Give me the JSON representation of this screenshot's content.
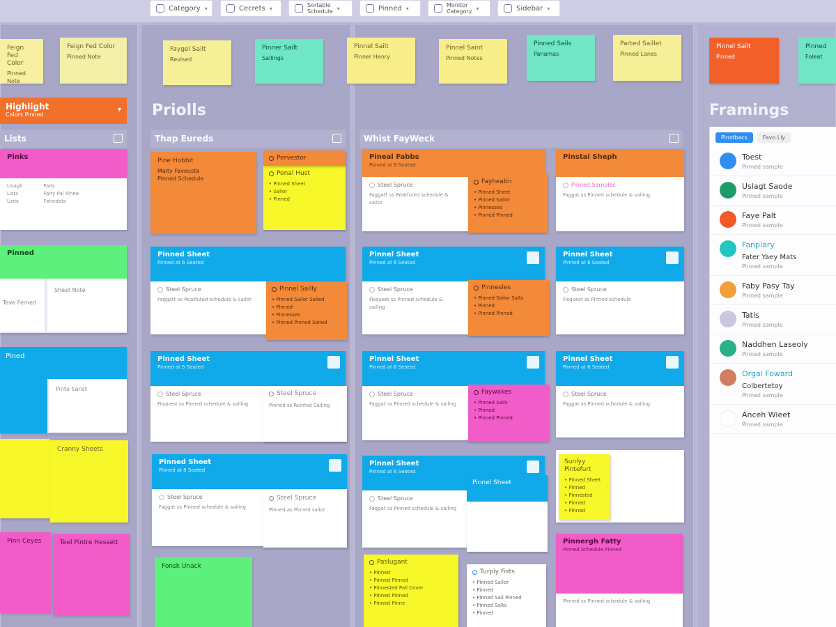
{
  "toolbar": {
    "buttons": [
      {
        "label": "Category"
      },
      {
        "label": "Cecrets"
      },
      {
        "label": "Sortable",
        "sub": "Schedule"
      },
      {
        "label": "Pinned"
      },
      {
        "label": "Monitor",
        "sub": "Category"
      },
      {
        "label": "Sidebar"
      }
    ]
  },
  "top_notes": [
    {
      "title": "Feign Fed Color",
      "sub": "Pinned Note"
    },
    {
      "title": "Faygel Sailt",
      "sub": "Revised"
    },
    {
      "title": "Pinner Sailt",
      "sub": "Sailings"
    },
    {
      "title": "Pinnel Sailt",
      "sub": "Pinner Henry"
    },
    {
      "title": "Pinnel Saint",
      "sub": "Pinned Notes"
    },
    {
      "title": "Pinned Sails",
      "sub": "Panamas"
    },
    {
      "title": "Parted Saillet",
      "sub": "Pinned Lanes"
    },
    {
      "title": "Pinnel Sailt",
      "sub": "Pinned"
    },
    {
      "title": "Pinned",
      "sub": "Foleat"
    }
  ],
  "left": {
    "orange_bar": {
      "title": "Highlight",
      "sub": "Colors Pinned"
    },
    "sec_head": "Lists",
    "pink_card": {
      "title": "Pinks",
      "lines": [
        "Lisagh",
        "Lists",
        "Lints"
      ],
      "lines2": [
        "Faits",
        "Fairy Pal Pinne",
        "Fenedats"
      ]
    },
    "green_card": {
      "title": "Pinned",
      "a": "Sheet Note",
      "b": "Teve Ferned"
    },
    "blue_card": {
      "title": "Pined",
      "a": "Pinte Sanst"
    },
    "yellow": {
      "title": "Cranny Sheets"
    },
    "pink_notes": {
      "a": "Pinn Ceyes",
      "b": "Teel Pintre Hessett"
    }
  },
  "middle": {
    "title": "Priolls",
    "sec_head": "Thap Eureds",
    "top_orange": {
      "title": "Pine Hobbit",
      "sub": "Maity Faveusta",
      "sub2": "Pinned Schedule"
    },
    "top_mini": {
      "title": "Pervestor",
      "sub": "Penal Hust",
      "items": [
        "Pinned Sheet",
        "Sailor",
        "Pinned"
      ]
    },
    "cards": [
      {
        "title": "Pinned Sheet",
        "sub": "Pinned at 6 Seated",
        "st": "Steel Spruce",
        "body": "Faggatt ss Reatfuted schedule & sailor"
      },
      {
        "title": "Pinned Sheet",
        "sub": "Pinned at 5 Seated",
        "st": "Steel Spruce",
        "body": "Fisquest ss Pinned schedule & sailing"
      },
      {
        "title": "Pinned Sheet",
        "sub": "Pinned at 8 Seated",
        "st": "Steel Spruce",
        "body": "Faggat ss Pinned schedule & sailing"
      }
    ],
    "mini_orange": {
      "title": "Pinnel Sailly",
      "items": [
        "Pinned Sailor Sailed",
        "Pinned",
        "Pinnesses",
        "Pinned Pinned Soiled"
      ]
    },
    "mini_white1": {
      "title": "Steel Spruce",
      "body": "Pinned ss Reinfed Sailing"
    },
    "mini_white2": {
      "title": "Steel Spruce",
      "body": "Pinned as Pinned sailor"
    },
    "green_bottom": {
      "title": "Fonsk Unack"
    }
  },
  "third": {
    "sec_head": "Whist FayWeck",
    "cards": [
      {
        "title": "Pineal Fabbs",
        "sub": "Pinned at 8 Seated",
        "st": "Steel Spruce",
        "body": "Faggatt ss Reatfuted schedule & sailor"
      },
      {
        "title": "Pinnel Sheet",
        "sub": "Pinned at 6 Seated",
        "st": "Steel Spruce",
        "body": "Fisquest ss Pinned schedule & sailing"
      },
      {
        "title": "Pinnel Sheet",
        "sub": "Pinned at 6 Seated",
        "st": "Steel Spruce",
        "body": "Faggat ss Pinned schedule & sailing"
      },
      {
        "title": "Pinnel Sheet",
        "sub": "Pinned at 6 Seated",
        "st": "Steel Spruce",
        "body": "Faggat ss Pinned schedule & sailing"
      }
    ],
    "minis": [
      {
        "title": "Fayheatin",
        "items": [
          "Pinned Sheet",
          "Pinned Sailor",
          "Pinnesses",
          "Pinned Pinned"
        ]
      },
      {
        "title": "Pinnesles",
        "items": [
          "Pinned Sailor Salts",
          "Pinned",
          "Pinned Pinned"
        ]
      },
      {
        "title": "Faywakes",
        "items": [
          "Pinned Sails",
          "Pinned",
          "Pinned Pinned"
        ]
      }
    ],
    "mini_blue": {
      "title": "Pinnel Sheet"
    },
    "bottom_yellow": {
      "title": "Paslugant",
      "items": [
        "Pinned",
        "Pinned Pinned",
        "Pinnested Pail Cover",
        "Pinned Pinned",
        "Pinned Pinne"
      ]
    },
    "bottom_white": {
      "title": "Turpiy Fists",
      "items": [
        "Pinned Sailor",
        "Pinned",
        "Pinned Sail Pinned",
        "Pinned Salts",
        "Pinned",
        "Pinned Pinned"
      ]
    }
  },
  "fourth": {
    "cards": [
      {
        "title": "Pinstal Sheph",
        "st": "Pinned Samples",
        "body": "Faggat ss Pinned schedule & sailing"
      },
      {
        "title": "Pinnel Sheet",
        "sub": "Pinned at 6 Seated",
        "st": "Steel Spruce",
        "body": "Fisquest ss Pinned schedule"
      },
      {
        "title": "Pinnel Sheet",
        "sub": "Pinned at 6 Seated",
        "st": "Steel Spruce",
        "body": "Faggat ss Pinned schedule & sailing"
      }
    ],
    "yellow_mini": {
      "title": "Sunlyy Pintefurt",
      "items": [
        "Pinned Sheet",
        "Pinned",
        "Pinnested",
        "Pinned",
        "Pinned"
      ]
    },
    "pink_card": {
      "title": "Pinnergh Fatty",
      "sub": "Pinned Schedule Pinned",
      "body": "Pinned ss Pinned schedule & sailing"
    }
  },
  "right": {
    "title": "Framings",
    "tabs": [
      "Pinstbacs",
      "Favo Lly"
    ],
    "items": [
      {
        "name": "Toest",
        "sub": "Pinned sample",
        "color": "#2f8ef0"
      },
      {
        "name": "Uslagt Saode",
        "sub": "Pinned sample",
        "color": "#1f9b6a"
      },
      {
        "name": "Faye Palt",
        "sub": "Pinned sample",
        "color": "#f25a2a"
      },
      {
        "name": "Fanplary",
        "sub": "Fater Yaey Mats",
        "sub2": "Pinned sample",
        "color": "#22c7c2",
        "accent": true
      },
      {
        "name": "Faby Pasy Tay",
        "sub": "Pinned sample",
        "color": "#f2a03a"
      },
      {
        "name": "Tatis",
        "sub": "Pinned sample",
        "color": "#c8c6e0"
      },
      {
        "name": "Naddhen Laseoly",
        "sub": "Pinned sample",
        "color": "#2bb08a"
      },
      {
        "name": "Orgal Foward",
        "sub": "Colbertetoy",
        "sub2": "Pinned sample",
        "color": "#d08060",
        "accent": true
      },
      {
        "name": "Anceh Wieet",
        "sub": "Pinned sample",
        "color": "#ffffff"
      }
    ]
  }
}
